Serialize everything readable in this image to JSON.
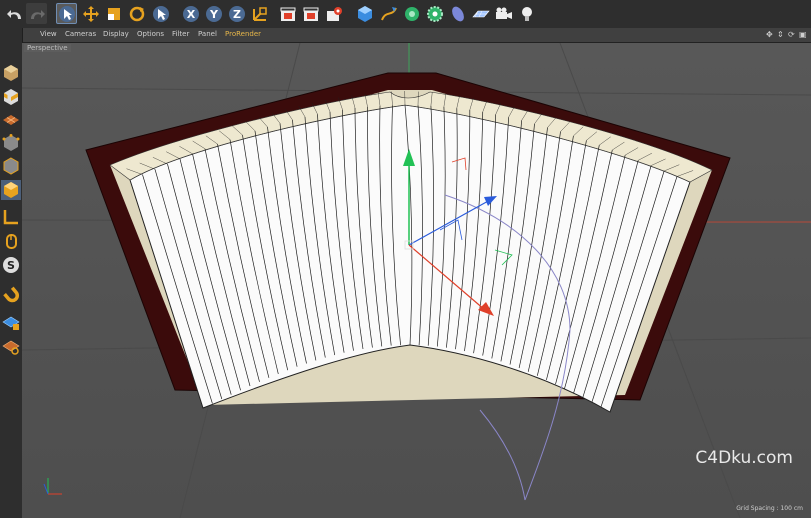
{
  "toolbar": {
    "buttons": [
      {
        "name": "undo-button",
        "icon": "undo-icon"
      },
      {
        "name": "redo-button",
        "icon": "redo-icon"
      },
      {
        "name": "live-selection-tool",
        "icon": "cursor-icon",
        "active": true
      },
      {
        "name": "move-tool",
        "icon": "move-icon"
      },
      {
        "name": "scale-tool",
        "icon": "scale-icon"
      },
      {
        "name": "rotate-tool",
        "icon": "rotate-icon"
      },
      {
        "name": "recent-tool",
        "icon": "cursor-icon"
      },
      {
        "name": "x-axis-lock",
        "icon": "x-axis-icon",
        "label": "X"
      },
      {
        "name": "y-axis-lock",
        "icon": "y-axis-icon",
        "label": "Y"
      },
      {
        "name": "z-axis-lock",
        "icon": "z-axis-icon",
        "label": "Z"
      },
      {
        "name": "coordinate-system-toggle",
        "icon": "world-coord-icon"
      },
      {
        "name": "render-view-button",
        "icon": "clapper-icon"
      },
      {
        "name": "render-picture-viewer-button",
        "icon": "clapper-icon"
      },
      {
        "name": "render-settings-button",
        "icon": "gear-clapper-icon"
      },
      {
        "name": "cube-button",
        "icon": "cube-icon"
      },
      {
        "name": "pen-spline-button",
        "icon": "pen-icon"
      },
      {
        "name": "subdivision-button",
        "icon": "nurbs-icon"
      },
      {
        "name": "array-button",
        "icon": "gear-icon"
      },
      {
        "name": "deformer-button",
        "icon": "bend-icon"
      },
      {
        "name": "floor-button",
        "icon": "floor-icon"
      },
      {
        "name": "camera-button",
        "icon": "camera-icon"
      },
      {
        "name": "light-button",
        "icon": "light-bulb-icon"
      }
    ]
  },
  "menubar": {
    "items": [
      "View",
      "Cameras",
      "Display",
      "Options",
      "Filter",
      "Panel",
      "ProRender"
    ],
    "highlight": "ProRender",
    "nav_icons": [
      "move-view-icon",
      "zoom-view-icon",
      "rotate-view-icon",
      "maximize-view-icon"
    ]
  },
  "left_toolbar": {
    "buttons": [
      {
        "name": "make-editable-button",
        "icon": "make-editable-icon"
      },
      {
        "name": "model-mode-button",
        "icon": "checker-cube-icon"
      },
      {
        "name": "texture-mode-button",
        "icon": "texture-icon"
      },
      {
        "name": "points-mode-button",
        "icon": "points-icon"
      },
      {
        "name": "edges-mode-button",
        "icon": "edges-icon"
      },
      {
        "name": "polygons-mode-button",
        "icon": "polygons-icon",
        "active": true
      },
      {
        "name": "axis-mode-button",
        "icon": "axis-icon"
      },
      {
        "name": "tweak-mode-button",
        "icon": "mouse-icon"
      },
      {
        "name": "snap-button",
        "icon": "snap-icon"
      },
      {
        "name": "magnet-button",
        "icon": "magnet-icon"
      },
      {
        "name": "workplane-lock-button",
        "icon": "lock-grid-icon"
      },
      {
        "name": "workplane-button",
        "icon": "grid-icon"
      }
    ]
  },
  "viewport": {
    "label": "Perspective",
    "grid_spacing": "Grid Spacing : 100 cm"
  },
  "watermark": "C4Dku.com",
  "colors": {
    "cover": "#3b0b0b",
    "page_edge": "#e8e2cc",
    "page": "#fbfbfb",
    "axis_y": "#22c155",
    "axis_x": "#e0402a",
    "axis_z": "#2a5bdc",
    "active_tool": "#6f8db3"
  }
}
